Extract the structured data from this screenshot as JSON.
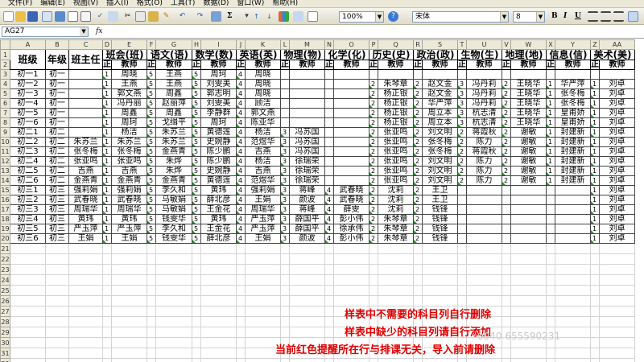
{
  "menu": [
    "文件(F)",
    "编辑(E)",
    "视图(V)",
    "插入(I)",
    "格式(O)",
    "工具(T)",
    "数据(D)",
    "窗口(W)",
    "帮助(H)"
  ],
  "toolbar": {
    "zoom": "100%",
    "font": "宋体",
    "size": "8",
    "bold": "B",
    "italic": "I",
    "underline": "U"
  },
  "namebox": "AG27",
  "fx": "fx",
  "col_letters": [
    "A",
    "B",
    "C",
    "D",
    "E",
    "F",
    "G",
    "H",
    "I",
    "J",
    "K",
    "L",
    "M",
    "N",
    "O",
    "P",
    "Q",
    "R",
    "S",
    "T",
    "U",
    "V",
    "W",
    "X",
    "Y",
    "Z",
    "AA"
  ],
  "row_numbers": [
    "1",
    "2",
    "3",
    "4",
    "5",
    "6",
    "7",
    "8",
    "9",
    "10",
    "11",
    "12",
    "13",
    "14",
    "15",
    "16",
    "17",
    "18",
    "19",
    "20",
    "21",
    "22",
    "23",
    "24",
    "25",
    "26",
    "27",
    "28",
    "29",
    "30",
    "31",
    "32"
  ],
  "headers": {
    "cls": "班级",
    "grade": "年级",
    "head": "班主任",
    "subjects": [
      "班会(班)",
      "语文(语)",
      "数学(数)",
      "英语(英)",
      "物理(物)",
      "化学(化)",
      "历史(史)",
      "政治(政)",
      "生物(生)",
      "地理(地)",
      "信息(信)",
      "美术(美)"
    ],
    "sub_n": "正",
    "sub_t": "教师"
  },
  "rows": [
    [
      "初一1",
      "初一",
      "",
      "1",
      "周晓",
      "5",
      "王燕",
      "5",
      "周珂",
      "4",
      "周晓",
      "",
      "",
      "",
      "",
      "",
      "",
      "",
      "",
      "",
      "",
      "",
      "",
      "",
      "",
      "",
      ""
    ],
    [
      "初一2",
      "初一",
      "",
      "1",
      "王燕",
      "5",
      "王燕",
      "5",
      "刘雯美",
      "4",
      "周晓",
      "",
      "",
      "",
      "",
      "2",
      "朱琴章",
      "2",
      "赵文金",
      "3",
      "冯丹莉",
      "2",
      "王晓华",
      "1",
      "华严萍",
      "1",
      "刘卓"
    ],
    [
      "初一3",
      "初一",
      "",
      "1",
      "郭文燕",
      "5",
      "周鑫",
      "5",
      "郭志明",
      "4",
      "周晓",
      "",
      "",
      "",
      "",
      "2",
      "杨正银",
      "2",
      "赵文金",
      "3",
      "冯丹莉",
      "2",
      "王晓华",
      "1",
      "张冬梅",
      "1",
      "刘卓"
    ],
    [
      "初一4",
      "初一",
      "",
      "1",
      "冯丹丽",
      "5",
      "赵丽萍",
      "5",
      "刘雯美",
      "4",
      "顾洁",
      "",
      "",
      "",
      "",
      "2",
      "杨正银",
      "2",
      "华严萍",
      "3",
      "冯丹莉",
      "2",
      "王晓华",
      "1",
      "张冬梅",
      "1",
      "刘卓"
    ],
    [
      "初一5",
      "初一",
      "",
      "1",
      "周鑫",
      "5",
      "周鑫",
      "5",
      "李静群",
      "4",
      "郭文燕",
      "",
      "",
      "",
      "",
      "2",
      "杨正银",
      "2",
      "周立本",
      "3",
      "杭志清",
      "2",
      "王晓华",
      "1",
      "皇甫娇",
      "1",
      "刘卓"
    ],
    [
      "初一6",
      "初一",
      "",
      "1",
      "周珂",
      "5",
      "戈缉平",
      "5",
      "周珂",
      "4",
      "陈亚华",
      "",
      "",
      "",
      "",
      "2",
      "杨正银",
      "2",
      "周立本",
      "3",
      "杭志清",
      "2",
      "王晓华",
      "1",
      "皇甫娇",
      "1",
      "刘卓"
    ],
    [
      "初二1",
      "初二",
      "",
      "1",
      "杨洁",
      "5",
      "朱苏兰",
      "5",
      "黄德莲",
      "4",
      "杨洁",
      "3",
      "冯苏国",
      "",
      "",
      "2",
      "张亚鸣",
      "2",
      "刘文明",
      "2",
      "蒋霞秋",
      "2",
      "谢敏",
      "1",
      "封建新",
      "1",
      "刘卓"
    ],
    [
      "初二2",
      "初二",
      "朱苏兰",
      "1",
      "朱苏兰",
      "5",
      "朱苏兰",
      "5",
      "史婉静",
      "4",
      "范煜华",
      "3",
      "冯苏国",
      "",
      "",
      "2",
      "张亚鸣",
      "2",
      "张冬梅",
      "2",
      "陈力",
      "2",
      "谢敏",
      "1",
      "封建新",
      "1",
      "刘卓"
    ],
    [
      "初二3",
      "初二",
      "张冬梅",
      "1",
      "张冬梅",
      "5",
      "金燕青",
      "5",
      "陈少鹏",
      "4",
      "吉燕",
      "3",
      "冯苏国",
      "",
      "",
      "2",
      "张亚鸣",
      "2",
      "张冬梅",
      "2",
      "蒋霞秋",
      "2",
      "谢敏",
      "1",
      "封建新",
      "1",
      "刘卓"
    ],
    [
      "初二4",
      "初二",
      "张亚鸣",
      "1",
      "张亚鸣",
      "5",
      "朱烨",
      "5",
      "陈少鹏",
      "4",
      "杨洁",
      "3",
      "徐瑞荣",
      "",
      "",
      "2",
      "张亚鸣",
      "2",
      "刘文明",
      "2",
      "陈力",
      "2",
      "谢敏",
      "1",
      "封建新",
      "1",
      "刘卓"
    ],
    [
      "初二5",
      "初二",
      "吉燕",
      "1",
      "吉燕",
      "5",
      "朱烨",
      "5",
      "史婉静",
      "4",
      "吉燕",
      "3",
      "徐瑞荣",
      "",
      "",
      "2",
      "张亚鸣",
      "2",
      "刘文明",
      "2",
      "陈力",
      "2",
      "谢敏",
      "1",
      "封建新",
      "1",
      "刘卓"
    ],
    [
      "初二6",
      "初二",
      "金燕青",
      "1",
      "金燕青",
      "5",
      "金燕青",
      "5",
      "黄德莲",
      "4",
      "范煜华",
      "3",
      "徐瑞荣",
      "",
      "",
      "2",
      "张亚鸣",
      "2",
      "刘文明",
      "2",
      "陈力",
      "2",
      "谢敏",
      "1",
      "封建新",
      "1",
      "刘卓"
    ],
    [
      "初三1",
      "初三",
      "强莉娟",
      "1",
      "强莉娟",
      "5",
      "李久和",
      "5",
      "黄玮",
      "4",
      "强莉娟",
      "3",
      "蒋峰",
      "4",
      "武春晓",
      "2",
      "沈莉",
      "2",
      "王卫",
      "",
      "",
      "",
      "",
      "",
      "",
      "1",
      "刘卓"
    ],
    [
      "初三2",
      "初三",
      "武春晓",
      "1",
      "武春晓",
      "5",
      "马敏娟",
      "5",
      "薛北彦",
      "4",
      "王娟",
      "3",
      "颜波",
      "4",
      "武春晓",
      "2",
      "沈莉",
      "2",
      "王卫",
      "",
      "",
      "",
      "",
      "",
      "",
      "1",
      "刘卓"
    ],
    [
      "初三3",
      "初三",
      "周瑞华",
      "1",
      "周瑞华",
      "5",
      "马敏娟",
      "5",
      "王金花",
      "4",
      "周瑞华",
      "3",
      "蒋峰",
      "4",
      "薛雯",
      "2",
      "沈莉",
      "2",
      "钱锋",
      "",
      "",
      "",
      "",
      "",
      "",
      "1",
      "刘卓"
    ],
    [
      "初三4",
      "初三",
      "黄玮",
      "1",
      "黄玮",
      "5",
      "钱雯华",
      "5",
      "黄玮",
      "4",
      "严玉萍",
      "3",
      "薛国平",
      "4",
      "彭小伟",
      "2",
      "朱琴章",
      "2",
      "钱锋",
      "",
      "",
      "",
      "",
      "",
      "",
      "1",
      "刘卓"
    ],
    [
      "初三5",
      "初三",
      "严玉萍",
      "1",
      "严玉萍",
      "5",
      "李久和",
      "5",
      "王金花",
      "4",
      "严玉萍",
      "3",
      "薛国平",
      "4",
      "徐承伟",
      "2",
      "朱琴章",
      "2",
      "钱锋",
      "",
      "",
      "",
      "",
      "",
      "",
      "1",
      "刘卓"
    ],
    [
      "初三6",
      "初三",
      "王娟",
      "1",
      "王娟",
      "5",
      "钱雯华",
      "5",
      "薛北彦",
      "4",
      "王娟",
      "3",
      "颜波",
      "4",
      "彭小伟",
      "2",
      "朱琴章",
      "2",
      "钱锋",
      "",
      "",
      "",
      "",
      "",
      "",
      "1",
      "刘卓"
    ]
  ],
  "notes": [
    "样表中不需要的科目列自行删除",
    "样表中缺少的科目列请自行添加",
    "当前红色提醒所在行与排课无关，导入前请删除"
  ],
  "watermark": "0040 6555902​31"
}
